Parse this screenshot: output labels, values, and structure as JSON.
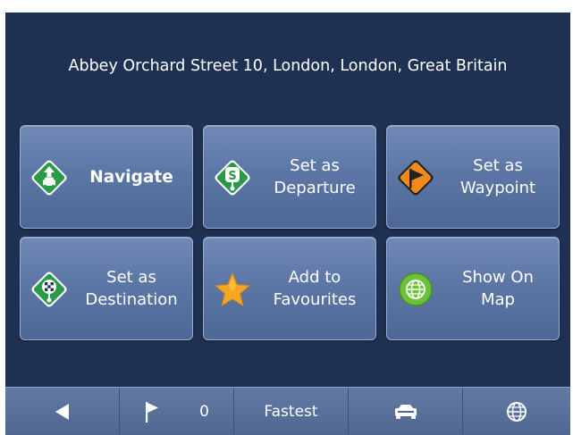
{
  "address": "Abbey Orchard Street 10, London, London, Great Britain",
  "actions": [
    {
      "line1": "Navigate",
      "line2": "",
      "icon": "navigate-icon",
      "color": "#2a9a48"
    },
    {
      "line1": "Set as",
      "line2": "Departure",
      "icon": "departure-icon",
      "color": "#2a9a48"
    },
    {
      "line1": "Set as",
      "line2": "Waypoint",
      "icon": "waypoint-flag-icon",
      "color": "#f08a1a"
    },
    {
      "line1": "Set as",
      "line2": "Destination",
      "icon": "destination-icon",
      "color": "#2a9a48"
    },
    {
      "line1": "Add to",
      "line2": "Favourites",
      "icon": "star-icon",
      "color": "#f5a623"
    },
    {
      "line1": "Show On",
      "line2": "Map",
      "icon": "globe-icon",
      "color": "#6cc13a"
    }
  ],
  "bottom_bar": {
    "back_icon": "back-arrow-icon",
    "waypoint_icon": "flag-icon",
    "waypoint_count": "0",
    "route_mode": "Fastest",
    "vehicle_icon": "car-icon",
    "map_icon": "globe-icon"
  },
  "colors": {
    "background": "#1f3152",
    "tile": "#5c76a6",
    "bar": "#5a729c"
  }
}
